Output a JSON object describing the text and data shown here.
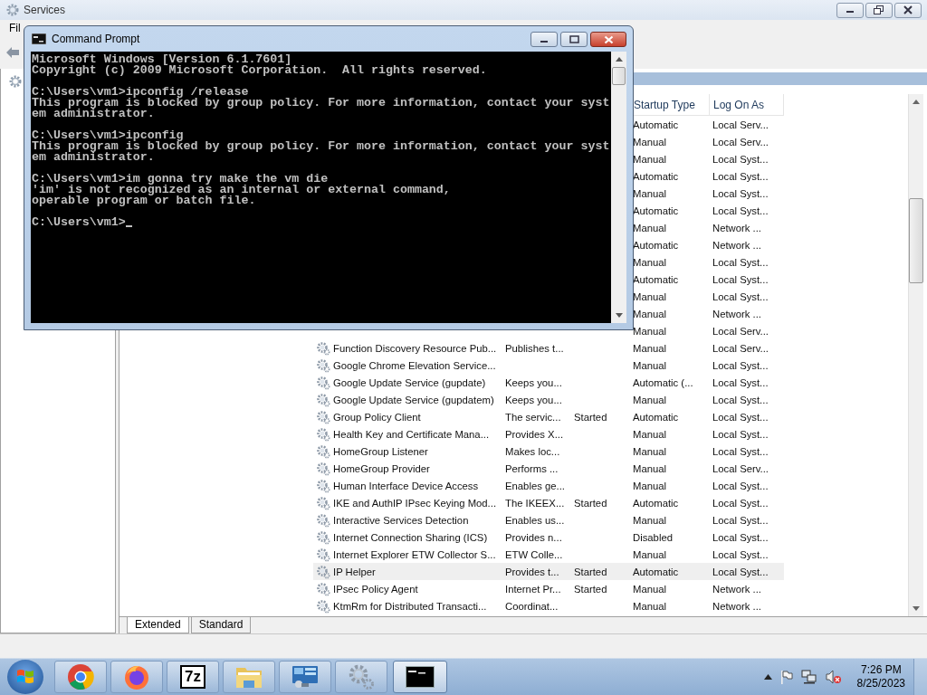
{
  "services_window": {
    "title": "Services",
    "menu": [
      "Fil"
    ],
    "columns": {
      "startup": "Startup Type",
      "logon": "Log On As"
    },
    "rows": [
      {
        "startup": "Automatic",
        "logon": "Local Serv...",
        "selected": false
      },
      {
        "startup": "Manual",
        "logon": "Local Serv...",
        "selected": false
      },
      {
        "startup": "Manual",
        "logon": "Local Syst...",
        "selected": false
      },
      {
        "startup": "Automatic",
        "logon": "Local Syst...",
        "selected": false
      },
      {
        "startup": "Manual",
        "logon": "Local Syst...",
        "selected": false
      },
      {
        "startup": "Automatic",
        "logon": "Local Syst...",
        "selected": false
      },
      {
        "startup": "Manual",
        "logon": "Network ...",
        "selected": false
      },
      {
        "startup": "Automatic",
        "logon": "Network ...",
        "selected": false
      },
      {
        "startup": "Manual",
        "logon": "Local Syst...",
        "selected": false
      },
      {
        "startup": "Automatic",
        "logon": "Local Syst...",
        "selected": false
      },
      {
        "startup": "Manual",
        "logon": "Local Syst...",
        "selected": false
      },
      {
        "startup": "Manual",
        "logon": "Network ...",
        "selected": false
      },
      {
        "startup": "Manual",
        "logon": "Local Serv...",
        "selected": false
      },
      {
        "name": "Function Discovery Resource Pub...",
        "description": "Publishes t...",
        "startup": "Manual",
        "logon": "Local Serv...",
        "selected": false
      },
      {
        "name": "Google Chrome Elevation Service...",
        "startup": "Manual",
        "logon": "Local Syst...",
        "selected": false
      },
      {
        "name": "Google Update Service (gupdate)",
        "description": "Keeps you...",
        "startup": "Automatic (...",
        "logon": "Local Syst...",
        "selected": false
      },
      {
        "name": "Google Update Service (gupdatem)",
        "description": "Keeps you...",
        "startup": "Manual",
        "logon": "Local Syst...",
        "selected": false
      },
      {
        "name": "Group Policy Client",
        "description": "The servic...",
        "status": "Started",
        "startup": "Automatic",
        "logon": "Local Syst...",
        "selected": false
      },
      {
        "name": "Health Key and Certificate Mana...",
        "description": "Provides X...",
        "startup": "Manual",
        "logon": "Local Syst...",
        "selected": false
      },
      {
        "name": "HomeGroup Listener",
        "description": "Makes loc...",
        "startup": "Manual",
        "logon": "Local Syst...",
        "selected": false
      },
      {
        "name": "HomeGroup Provider",
        "description": "Performs ...",
        "startup": "Manual",
        "logon": "Local Serv...",
        "selected": false
      },
      {
        "name": "Human Interface Device Access",
        "description": "Enables ge...",
        "startup": "Manual",
        "logon": "Local Syst...",
        "selected": false
      },
      {
        "name": "IKE and AuthIP IPsec Keying Mod...",
        "description": "The IKEEX...",
        "status": "Started",
        "startup": "Automatic",
        "logon": "Local Syst...",
        "selected": false
      },
      {
        "name": "Interactive Services Detection",
        "description": "Enables us...",
        "startup": "Manual",
        "logon": "Local Syst...",
        "selected": false
      },
      {
        "name": "Internet Connection Sharing (ICS)",
        "description": "Provides n...",
        "startup": "Disabled",
        "logon": "Local Syst...",
        "selected": false
      },
      {
        "name": "Internet Explorer ETW Collector S...",
        "description": "ETW Colle...",
        "startup": "Manual",
        "logon": "Local Syst...",
        "selected": false
      },
      {
        "name": "IP Helper",
        "description": "Provides t...",
        "status": "Started",
        "startup": "Automatic",
        "logon": "Local Syst...",
        "selected": true
      },
      {
        "name": "IPsec Policy Agent",
        "description": "Internet Pr...",
        "status": "Started",
        "startup": "Manual",
        "logon": "Network ...",
        "selected": false
      },
      {
        "name": "KtmRm for Distributed Transacti...",
        "description": "Coordinat...",
        "startup": "Manual",
        "logon": "Network ...",
        "selected": false
      }
    ],
    "tabs": [
      {
        "label": "Extended",
        "selected": true
      },
      {
        "label": "Standard",
        "selected": false
      }
    ]
  },
  "command_prompt": {
    "title": "Command Prompt",
    "blocks": [
      [
        "Microsoft Windows [Version 6.1.7601]",
        "Copyright (c) 2009 Microsoft Corporation.  All rights reserved."
      ],
      [
        "C:\\Users\\vm1>ipconfig /release",
        "This program is blocked by group policy. For more information, contact your syst",
        "em administrator."
      ],
      [
        "C:\\Users\\vm1>ipconfig",
        "This program is blocked by group policy. For more information, contact your syst",
        "em administrator."
      ],
      [
        "C:\\Users\\vm1>im gonna try make the vm die",
        "'im' is not recognized as an internal or external command,",
        "operable program or batch file."
      ],
      [
        "C:\\Users\\vm1>"
      ]
    ]
  },
  "taskbar": {
    "apps": [
      {
        "kind": "chrome",
        "active": false
      },
      {
        "kind": "firefox",
        "active": false
      },
      {
        "kind": "sevenzip",
        "label": "7z",
        "active": false
      },
      {
        "kind": "folder",
        "active": false
      },
      {
        "kind": "control",
        "active": false
      },
      {
        "kind": "gears",
        "active": false
      },
      {
        "kind": "console",
        "active": true
      }
    ],
    "time": "7:26 PM",
    "date": "8/25/2023"
  }
}
